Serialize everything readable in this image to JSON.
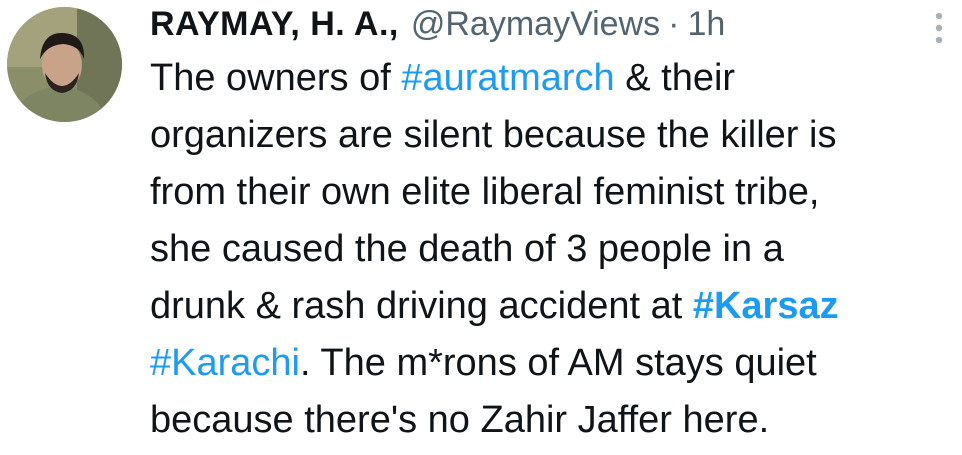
{
  "header": {
    "display_name": "RAYMAY, H. A.,",
    "handle": "@RaymayViews",
    "separator": "·",
    "time": "1h"
  },
  "icons": {
    "avatar": "user-avatar",
    "more": "more-vertical-icon"
  },
  "colors": {
    "text": "#0f1419",
    "muted": "#536471",
    "hashtag": "#1d9bf0"
  },
  "tweet": {
    "hashtags": {
      "auratmarch": "#auratmarch",
      "karsaz": "#Karsaz",
      "karachi": "#Karachi"
    },
    "segments": {
      "s1": "The owners of ",
      "s2": " & their",
      "s3": "organizers are silent because the killer is",
      "s4": "from their own elite liberal feminist tribe,",
      "s5": "she caused the death of 3 people in a",
      "s6": "drunk & rash driving accident at ",
      "s7": ". The m*rons of AM stays quiet",
      "s8": "because there's no Zahir Jaffer here."
    }
  }
}
